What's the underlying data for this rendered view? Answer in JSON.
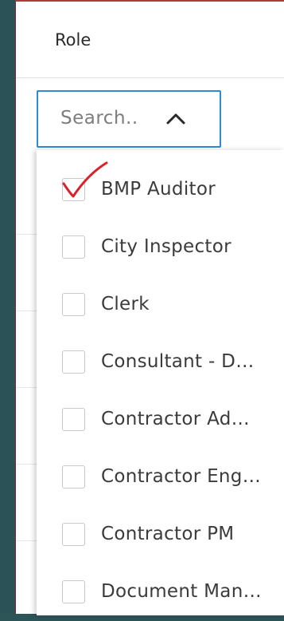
{
  "header": {
    "title": "Role"
  },
  "search": {
    "placeholder": "Search.."
  },
  "options": [
    {
      "label": "BMP Auditor",
      "checked": true
    },
    {
      "label": "City Inspector",
      "checked": false
    },
    {
      "label": "Clerk",
      "checked": false
    },
    {
      "label": "Consultant - D…",
      "checked": false
    },
    {
      "label": "Contractor Ad…",
      "checked": false
    },
    {
      "label": "Contractor Eng…",
      "checked": false
    },
    {
      "label": "Contractor PM",
      "checked": false
    },
    {
      "label": "Document Man…",
      "checked": false
    }
  ],
  "colors": {
    "accent": "#2d8ad8",
    "annotation": "#d9222b",
    "background": "#2d5457"
  },
  "icons": {
    "dropdown_toggle": "chevron-up-icon",
    "annotation": "check-mark-icon"
  }
}
